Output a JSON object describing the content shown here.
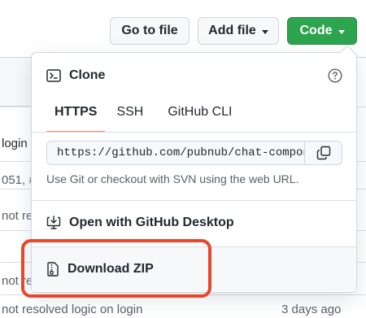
{
  "toolbar": {
    "goto_label": "Go to file",
    "add_label": "Add file",
    "code_label": "Code"
  },
  "background": {
    "fragments": [
      "login",
      "051, #",
      "not re",
      "not re"
    ],
    "bottom_text": "not resolved logic on login",
    "bottom_date": "3 days ago"
  },
  "clone": {
    "title": "Clone",
    "tabs": [
      "HTTPS",
      "SSH",
      "GitHub CLI"
    ],
    "active_tab": "HTTPS",
    "url": "https://github.com/pubnub/chat-components",
    "hint": "Use Git or checkout with SVN using the web URL."
  },
  "menu": {
    "desktop_label": "Open with GitHub Desktop",
    "zip_label": "Download ZIP"
  },
  "colors": {
    "code_button": "#2da44e",
    "tab_underline": "#fd8c73",
    "highlight": "#e8472c"
  },
  "icons": {
    "terminal": "terminal-icon",
    "help": "question-icon",
    "copy": "copy-icon",
    "desktop": "desktop-download-icon",
    "zip": "file-zip-icon",
    "caret": "caret-down-icon"
  }
}
